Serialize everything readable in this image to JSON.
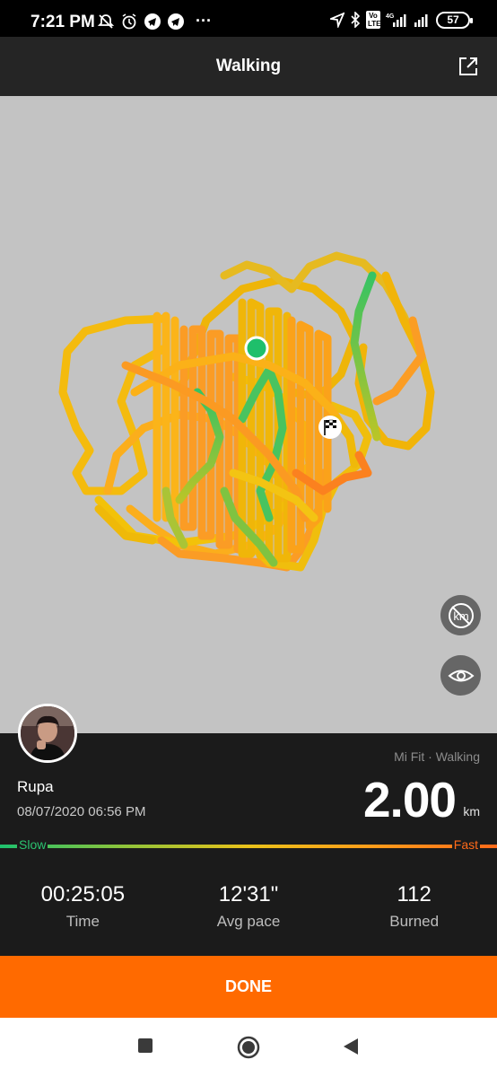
{
  "status_bar": {
    "time": "7:21 PM",
    "battery": "57",
    "network": "4G",
    "lte_badge": "Vo LTE"
  },
  "app_bar": {
    "title": "Walking",
    "share_icon": "share-icon"
  },
  "map": {
    "start_marker": "start-point-icon",
    "finish_marker": "finish-flag-icon",
    "buttons": [
      "km-markers-hidden-icon",
      "eye-icon"
    ],
    "route_colors": {
      "slow": "#1ec16e",
      "medium": "#f5c000",
      "fast": "#ff8c1a"
    }
  },
  "workout": {
    "source": "Mi Fit · Walking",
    "user_name": "Rupa",
    "datetime": "08/07/2020 06:56 PM",
    "distance": "2.00",
    "distance_unit": "km",
    "slow_label": "Slow",
    "fast_label": "Fast"
  },
  "stats": [
    {
      "value": "00:25:05",
      "label": "Time"
    },
    {
      "value": "12'31\"",
      "label": "Avg pace"
    },
    {
      "value": "112",
      "label": "Burned"
    }
  ],
  "done_label": "DONE",
  "nav": [
    "recents-icon",
    "home-icon",
    "back-icon"
  ],
  "colors": {
    "accent": "#ff6a00",
    "panel": "#1b1b1b",
    "header": "#252525"
  }
}
